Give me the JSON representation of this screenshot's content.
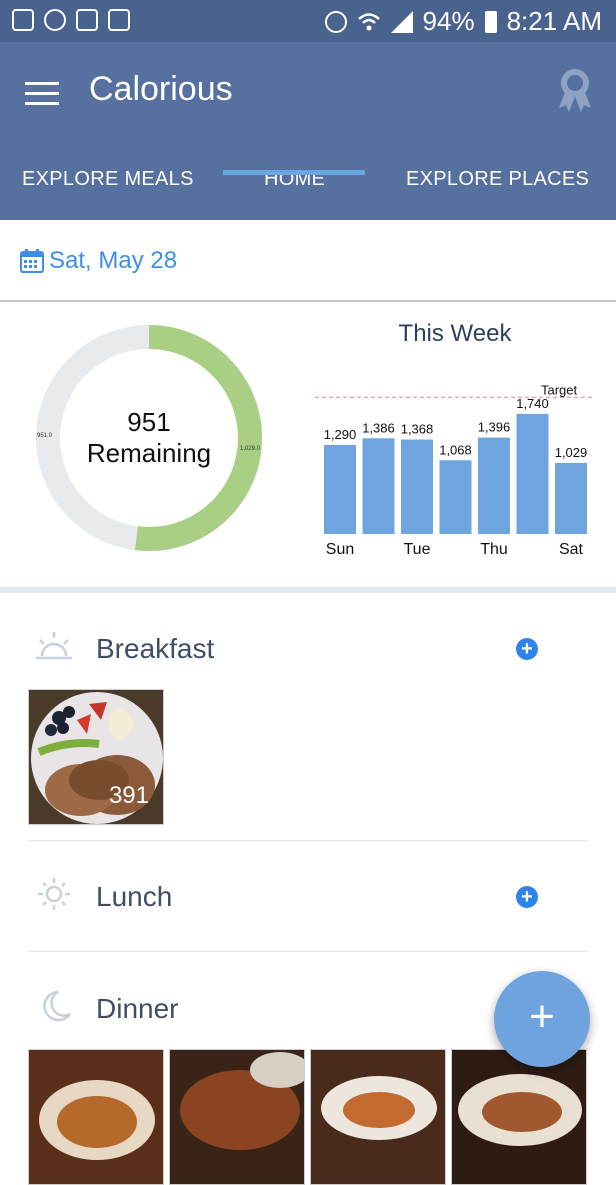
{
  "status_bar": {
    "battery": "94%",
    "time": "8:21 AM",
    "left_icons": [
      "gallery-icon",
      "chrome-icon",
      "vine-icon",
      "task-icon"
    ],
    "right_icons": [
      "alarm-icon",
      "wifi-icon",
      "signal-icon",
      "battery-icon"
    ]
  },
  "app_bar": {
    "title": "Calorious",
    "menu_icon": "hamburger-menu-icon",
    "badge_icon": "award-ribbon-icon"
  },
  "tabs": [
    {
      "label": "EXPLORE MEALS"
    },
    {
      "label": "HOME",
      "selected": true
    },
    {
      "label": "EXPLORE PLACES"
    }
  ],
  "date": {
    "label": "Sat, May 28",
    "icon": "calendar-icon"
  },
  "daily_summary": {
    "remaining_value": "951",
    "remaining_label": "Remaining",
    "donut_left_label": "951.0",
    "donut_right_label": "1,029.0",
    "remaining_fraction": 0.4803,
    "consumed_fraction": 0.5197,
    "colors": {
      "consumed": "#a8cf83",
      "remaining": "#e7ebee"
    }
  },
  "chart_data": {
    "type": "bar",
    "title": "This Week",
    "categories": [
      "Sun",
      "Mon",
      "Tue",
      "Wed",
      "Thu",
      "Fri",
      "Sat"
    ],
    "x_tick_labels": [
      "Sun",
      "",
      "Tue",
      "",
      "Thu",
      "",
      "Sat"
    ],
    "values": [
      1290,
      1386,
      1368,
      1068,
      1396,
      1740,
      1029
    ],
    "value_labels": [
      "1,290",
      "1,386",
      "1,368",
      "1,068",
      "1,396",
      "1,740",
      "1,029"
    ],
    "target_label": "Target",
    "target_value": 1980,
    "ylim": [
      0,
      2100
    ],
    "bar_color": "#6fa4df",
    "target_color": "#e5828f"
  },
  "meals": [
    {
      "name": "Breakfast",
      "icon": "sunrise-icon",
      "add_icon": "add-circle-icon",
      "photos": [
        {
          "calories": "391"
        }
      ]
    },
    {
      "name": "Lunch",
      "icon": "sun-icon",
      "add_icon": "add-circle-icon",
      "photos": []
    },
    {
      "name": "Dinner",
      "icon": "moon-icon",
      "photos": [
        {},
        {},
        {},
        {}
      ]
    }
  ],
  "fab": {
    "label": "+",
    "icon": "add-icon"
  }
}
